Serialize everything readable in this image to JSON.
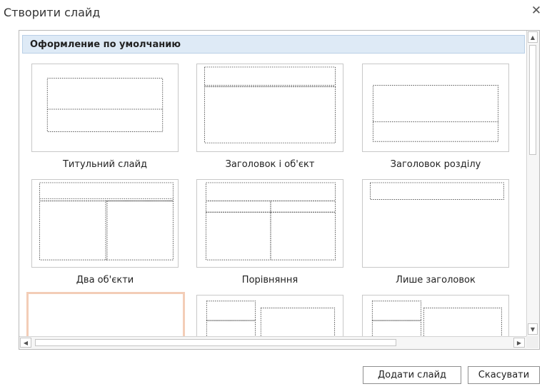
{
  "dialog": {
    "title": "Створити слайд",
    "close_glyph": "✕",
    "section_header": "Оформление по умолчанию",
    "layouts": [
      {
        "label": "Титульний слайд"
      },
      {
        "label": "Заголовок і об'єкт"
      },
      {
        "label": "Заголовок розділу"
      },
      {
        "label": "Два об'єкти"
      },
      {
        "label": "Порівняння"
      },
      {
        "label": "Лише заголовок"
      },
      {
        "label": ""
      },
      {
        "label": ""
      },
      {
        "label": ""
      }
    ],
    "add_button": "Додати слайд",
    "cancel_button": "Скасувати"
  }
}
